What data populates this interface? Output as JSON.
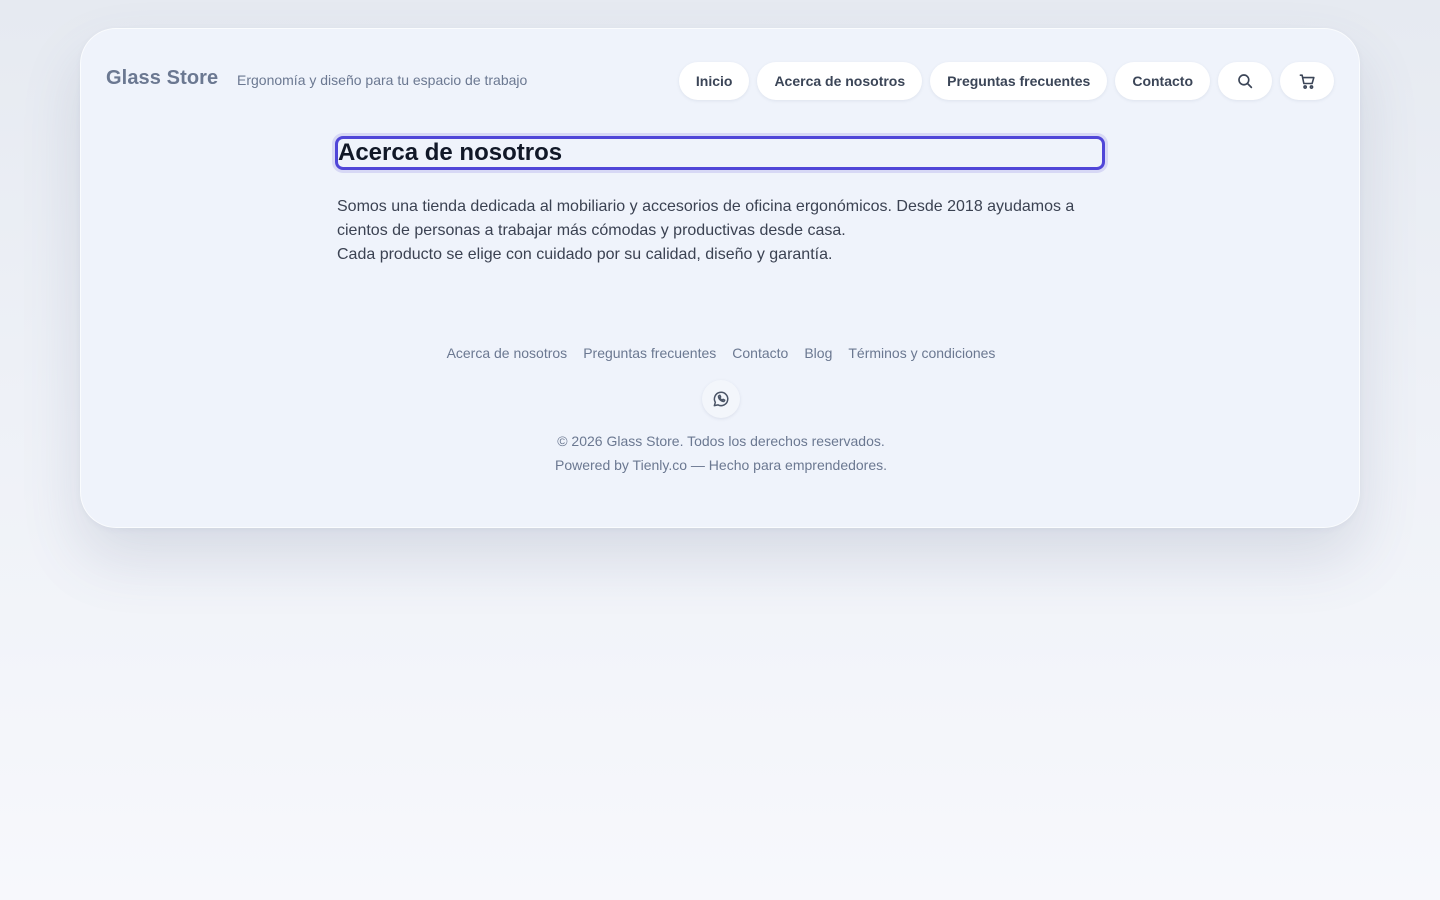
{
  "header": {
    "brand": "Glass Store",
    "tagline": "Ergonomía y diseño para tu espacio de trabajo",
    "nav": [
      {
        "label": "Inicio"
      },
      {
        "label": "Acerca de nosotros"
      },
      {
        "label": "Preguntas frecuentes"
      },
      {
        "label": "Contacto"
      }
    ],
    "icons": {
      "search": "search-icon",
      "cart": "cart-icon"
    }
  },
  "main": {
    "title": "Acerca de nosotros",
    "paragraph": [
      "Somos una tienda dedicada al mobiliario y accesorios de oficina ergonómicos. Desde 2018 ayudamos a",
      "cientos de personas a trabajar más cómodas y productivas desde casa.",
      "Cada producto se elige con cuidado por su calidad, diseño y garantía."
    ]
  },
  "footer": {
    "links": [
      {
        "label": "Acerca de nosotros"
      },
      {
        "label": "Preguntas frecuentes"
      },
      {
        "label": "Contacto"
      },
      {
        "label": "Blog"
      },
      {
        "label": "Términos y condiciones"
      }
    ],
    "social_icon": "whatsapp-icon",
    "copyright": "© 2026 Glass Store. Todos los derechos reservados.",
    "powered_by": "Powered by Tienly.co — Hecho para emprendedores."
  },
  "colors": {
    "focus_ring": "#5046d8",
    "muted_text": "#6b7891",
    "card_bg": "#eff3fb"
  }
}
